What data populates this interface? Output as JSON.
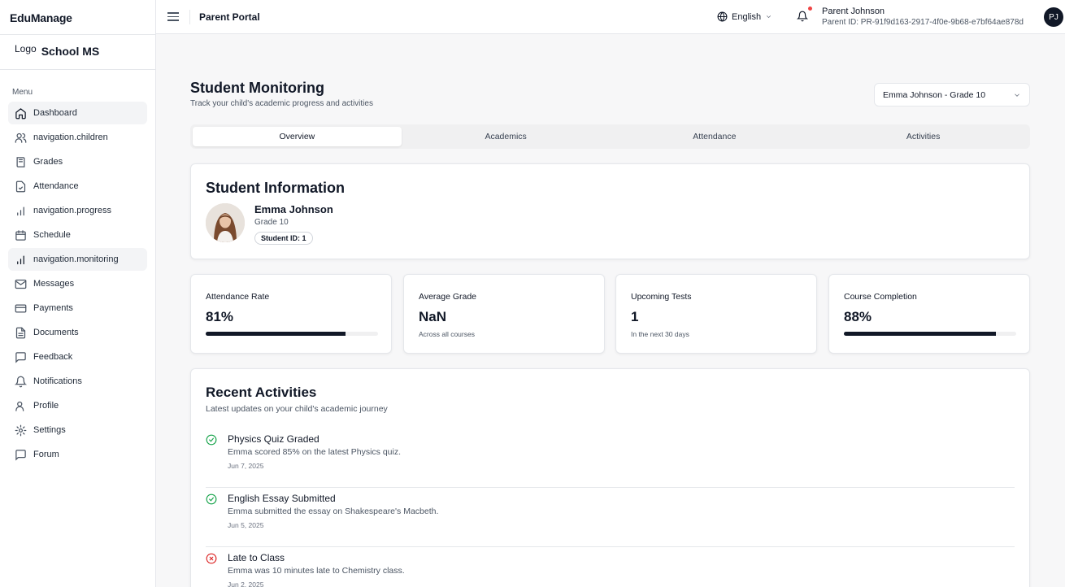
{
  "app": {
    "brand": "EduManage",
    "logo_text": "Logo",
    "school_name": "School MS",
    "menu_label": "Menu"
  },
  "sidebar": {
    "items": [
      {
        "label": "Dashboard",
        "icon": "home-icon"
      },
      {
        "label": "navigation.children",
        "icon": "users-icon"
      },
      {
        "label": "Grades",
        "icon": "book-icon"
      },
      {
        "label": "Attendance",
        "icon": "clipboard-check-icon"
      },
      {
        "label": "navigation.progress",
        "icon": "bar-chart-icon"
      },
      {
        "label": "Schedule",
        "icon": "calendar-icon"
      },
      {
        "label": "navigation.monitoring",
        "icon": "bar-chart-icon"
      },
      {
        "label": "Messages",
        "icon": "mail-icon"
      },
      {
        "label": "Payments",
        "icon": "credit-card-icon"
      },
      {
        "label": "Documents",
        "icon": "file-icon"
      },
      {
        "label": "Feedback",
        "icon": "message-square-icon"
      },
      {
        "label": "Notifications",
        "icon": "bell-icon"
      },
      {
        "label": "Profile",
        "icon": "user-icon"
      },
      {
        "label": "Settings",
        "icon": "gear-icon"
      },
      {
        "label": "Forum",
        "icon": "message-square-icon"
      }
    ]
  },
  "header": {
    "portal_title": "Parent Portal",
    "language": "English",
    "user_name": "Parent Johnson",
    "user_id": "Parent ID: PR-91f9d163-2917-4f0e-9b68-e7bf64ae878d",
    "avatar_initials": "PJ"
  },
  "main": {
    "title": "Student Monitoring",
    "subtitle": "Track your child's academic progress and activities",
    "student_select": "Emma Johnson - Grade 10",
    "tabs": [
      {
        "label": "Overview"
      },
      {
        "label": "Academics"
      },
      {
        "label": "Attendance"
      },
      {
        "label": "Activities"
      }
    ]
  },
  "student_info": {
    "title": "Student Information",
    "name": "Emma Johnson",
    "grade": "Grade 10",
    "student_id": "Student ID: 1"
  },
  "stats": [
    {
      "label": "Attendance Rate",
      "value": "81%",
      "progress": 81
    },
    {
      "label": "Average Grade",
      "value": "NaN",
      "note": "Across all courses"
    },
    {
      "label": "Upcoming Tests",
      "value": "1",
      "note": "In the next 30 days"
    },
    {
      "label": "Course Completion",
      "value": "88%",
      "progress": 88
    }
  ],
  "activities": {
    "title": "Recent Activities",
    "subtitle": "Latest updates on your child's academic journey",
    "items": [
      {
        "title": "Physics Quiz Graded",
        "desc": "Emma scored 85% on the latest Physics quiz.",
        "date": "Jun 7, 2025",
        "status": "success"
      },
      {
        "title": "English Essay Submitted",
        "desc": "Emma submitted the essay on Shakespeare's Macbeth.",
        "date": "Jun 5, 2025",
        "status": "success"
      },
      {
        "title": "Late to Class",
        "desc": "Emma was 10 minutes late to Chemistry class.",
        "date": "Jun 2, 2025",
        "status": "error"
      }
    ]
  },
  "colors": {
    "success": "#16a34a",
    "error": "#dc2626",
    "notification_dot": "#ef4444",
    "primary_dark": "#111827"
  }
}
